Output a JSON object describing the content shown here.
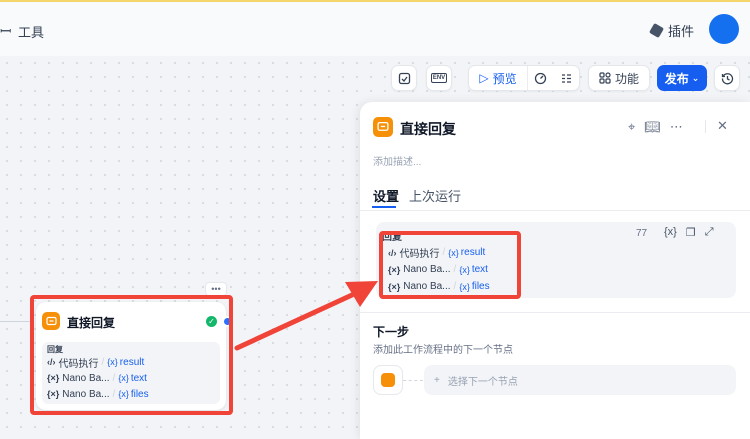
{
  "topbar": {
    "tools_label": "工具",
    "plugins_label": "插件"
  },
  "toolbar": {
    "env_label": "ENV",
    "preview_label": "预览",
    "features_label": "功能",
    "publish_label": "发布"
  },
  "node": {
    "title": "直接回复",
    "more_label": "•••",
    "reply_label": "回复",
    "vars": [
      {
        "source": "代码执行",
        "name": "result"
      },
      {
        "source": "Nano Ba...",
        "name": "text"
      },
      {
        "source": "Nano Ba...",
        "name": "files"
      }
    ]
  },
  "panel": {
    "title": "直接回复",
    "description_placeholder": "添加描述...",
    "tabs": [
      "设置",
      "上次运行"
    ],
    "reply": {
      "label": "回复",
      "char_count": "77",
      "insert_var_label": "{x}",
      "vars": [
        {
          "source": "代码执行",
          "name": "result"
        },
        {
          "source": "Nano Ba...",
          "name": "text"
        },
        {
          "source": "Nano Ba...",
          "name": "files"
        }
      ]
    },
    "next_step": {
      "title": "下一步",
      "description": "添加此工作流程中的下一个节点",
      "select_label": "选择下一个节点"
    }
  },
  "colors": {
    "accent": "#155eef",
    "node_icon": "#f79009",
    "highlight": "#f04438",
    "success": "#12b76a"
  }
}
